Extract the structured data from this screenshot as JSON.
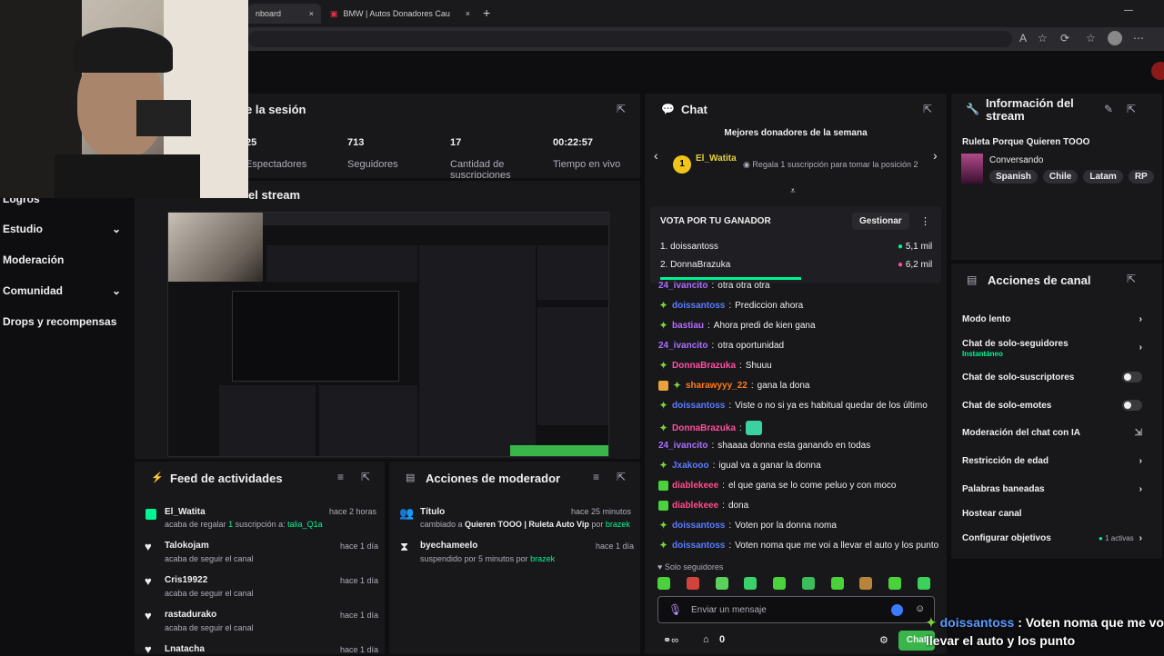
{
  "browser": {
    "tab1": "nboard",
    "tab2": "BMW | Autos Donadores Cau",
    "close": "×",
    "new_tab": "+",
    "minimize": "—"
  },
  "sidebar": {
    "items": [
      {
        "label": "Logros"
      },
      {
        "label": "Estudio",
        "chevron": "⌄"
      },
      {
        "label": "Moderación"
      },
      {
        "label": "Comunidad",
        "chevron": "⌄"
      },
      {
        "label": "Drops y recompensas"
      }
    ]
  },
  "session": {
    "title": "e la sesión",
    "stats": [
      {
        "value": "25",
        "label": "Espectadores"
      },
      {
        "value": "713",
        "label": "Seguidores"
      },
      {
        "value": "17",
        "label": "Cantidad de suscripciones"
      },
      {
        "value": "00:22:57",
        "label": "Tiempo en vivo"
      }
    ]
  },
  "preview": {
    "title": "el stream"
  },
  "feed": {
    "title": "Feed de actividades",
    "items": [
      {
        "name": "El_Watita",
        "time": "hace 2 horas",
        "sub_prefix": "acaba de regalar ",
        "sub_num": "1",
        "sub_mid": " suscripción a: ",
        "sub_target": "talia_Q1a",
        "icon": "gift"
      },
      {
        "name": "Talokojam",
        "time": "hace 1 día",
        "sub": "acaba de seguir el canal",
        "icon": "heart"
      },
      {
        "name": "Cris19922",
        "time": "hace 1 día",
        "sub": "acaba de seguir el canal",
        "icon": "heart"
      },
      {
        "name": "rastadurako",
        "time": "hace 1 día",
        "sub": "acaba de seguir el canal",
        "icon": "heart"
      },
      {
        "name": "Lnatacha",
        "time": "hace 1 día",
        "sub": "",
        "icon": "heart"
      }
    ]
  },
  "modactions": {
    "title": "Acciones de moderador",
    "items": [
      {
        "name": "Título",
        "time": "hace 25 minutos",
        "sub_prefix": "cambiado a ",
        "sub_bold": "Quieren TOOO | Ruleta Auto Vip",
        "sub_mid": " por ",
        "sub_by": "brazek"
      },
      {
        "name": "byechameelo",
        "time": "hace 1 día",
        "sub_prefix": "suspendido por 5 minutos por ",
        "sub_by": "brazek"
      }
    ]
  },
  "chat": {
    "title": "Chat",
    "top_title": "Mejores donadores de la semana",
    "top_rank": "1",
    "top_user": "El_Watita",
    "top_cta": "Regala 1 suscripción para tomar la posición 2",
    "poll_title": "VOTA POR TU GANADOR",
    "poll_manage": "Gestionar",
    "poll_options": [
      {
        "label": "1. doissantoss",
        "value": "5,1 mil"
      },
      {
        "label": "2. DonnaBrazuka",
        "value": "6,2 mil"
      }
    ],
    "messages": [
      {
        "user": "24_ivancito",
        "color": "#a970ff",
        "text": "otra otra otra",
        "badge": "none"
      },
      {
        "user": "doissantoss",
        "color": "#5b7cff",
        "text": "Prediccion ahora",
        "badge": "spark"
      },
      {
        "user": "bastiau",
        "color": "#b66bff",
        "text": "Ahora predi de kien gana",
        "badge": "spark"
      },
      {
        "user": "24_ivancito",
        "color": "#a970ff",
        "text": "otra oportunidad",
        "badge": "none"
      },
      {
        "user": "DonnaBrazuka",
        "color": "#ff4fa3",
        "text": "Shuuu",
        "badge": "spark"
      },
      {
        "user": "sharawyyy_22",
        "color": "#ff7a1a",
        "text": "gana la dona",
        "badge": "crown"
      },
      {
        "user": "doissantoss",
        "color": "#5b7cff",
        "text": "Viste o no si ya es habitual quedar de los último",
        "badge": "spark"
      },
      {
        "user": "DonnaBrazuka",
        "color": "#ff4fa3",
        "text": "",
        "badge": "spark"
      },
      {
        "user": "24_ivancito",
        "color": "#a970ff",
        "text": "shaaaa donna esta ganando en todas",
        "badge": "none"
      },
      {
        "user": "Jxakooo",
        "color": "#5b7cff",
        "text": "igual va a ganar la donna",
        "badge": "spark"
      },
      {
        "user": "diablekeee",
        "color": "#ff4d88",
        "text": "el que gana se lo come peluo y con moco",
        "badge": "sq"
      },
      {
        "user": "diablekeee",
        "color": "#ff4d88",
        "text": "dona",
        "badge": "sq"
      },
      {
        "user": "doissantoss",
        "color": "#5b7cff",
        "text": "Voten por la donna noma",
        "badge": "spark"
      },
      {
        "user": "doissantoss",
        "color": "#5b7cff",
        "text": "Voten noma que me voi a llevar el auto y los punto",
        "badge": "spark"
      }
    ],
    "followers_only": "Solo seguidores",
    "input_placeholder": "Enviar un mensaje",
    "points": "0",
    "send_label": "Chat"
  },
  "overlay": {
    "user": "doissantoss",
    "line1": " : Voten noma que me voi",
    "line2": "llevar el auto y los punto"
  },
  "streaminfo": {
    "title": "Información del stream",
    "stream_title": "Ruleta Porque Quieren TOOO",
    "category": "Conversando",
    "tags": [
      "Spanish",
      "Chile",
      "Latam",
      "RP"
    ]
  },
  "channel_actions": {
    "title": "Acciones de canal",
    "items": [
      {
        "label": "Modo lento",
        "control": "chevron"
      },
      {
        "label": "Chat de solo-seguidores",
        "sub": "Instantáneo",
        "control": "chevron"
      },
      {
        "label": "Chat de solo-suscriptores",
        "control": "toggle"
      },
      {
        "label": "Chat de solo-emotes",
        "control": "toggle"
      },
      {
        "label": "Moderación del chat con IA",
        "control": "external"
      },
      {
        "label": "Restricción de edad",
        "control": "chevron"
      },
      {
        "label": "Palabras baneadas",
        "control": "chevron"
      },
      {
        "label": "Hostear canal",
        "control": "none"
      },
      {
        "label": "Configurar objetivos",
        "badge": "1 activas",
        "control": "chevron"
      }
    ]
  },
  "colors": {
    "accent": "#00f593",
    "brand": "#9147ff",
    "panel": "#18181b",
    "bg": "#0e0e10"
  }
}
